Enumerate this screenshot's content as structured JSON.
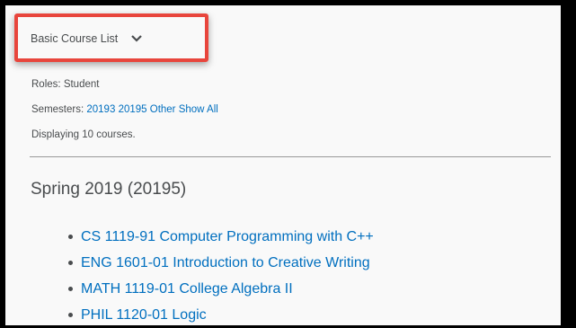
{
  "course_view": {
    "dropdown_label": "Basic Course List",
    "dropdown_icon": "chevron-down-icon"
  },
  "filters": {
    "roles_label": "Roles:",
    "roles_value": "Student",
    "semesters_label": "Semesters:",
    "semester_links": [
      "20193",
      "20195",
      "Other",
      "Show All"
    ],
    "count_text": "Displaying 10 courses."
  },
  "semester": {
    "title": "Spring 2019 (20195)",
    "courses": [
      "CS 1119-91 Computer Programming with C++",
      "ENG 1601-01 Introduction to Creative Writing",
      "MATH 1119-01 College Algebra II",
      "PHIL 1120-01 Logic"
    ]
  },
  "colors": {
    "link": "#006fbf",
    "text": "#494c4e",
    "highlight": "#e8453c"
  }
}
